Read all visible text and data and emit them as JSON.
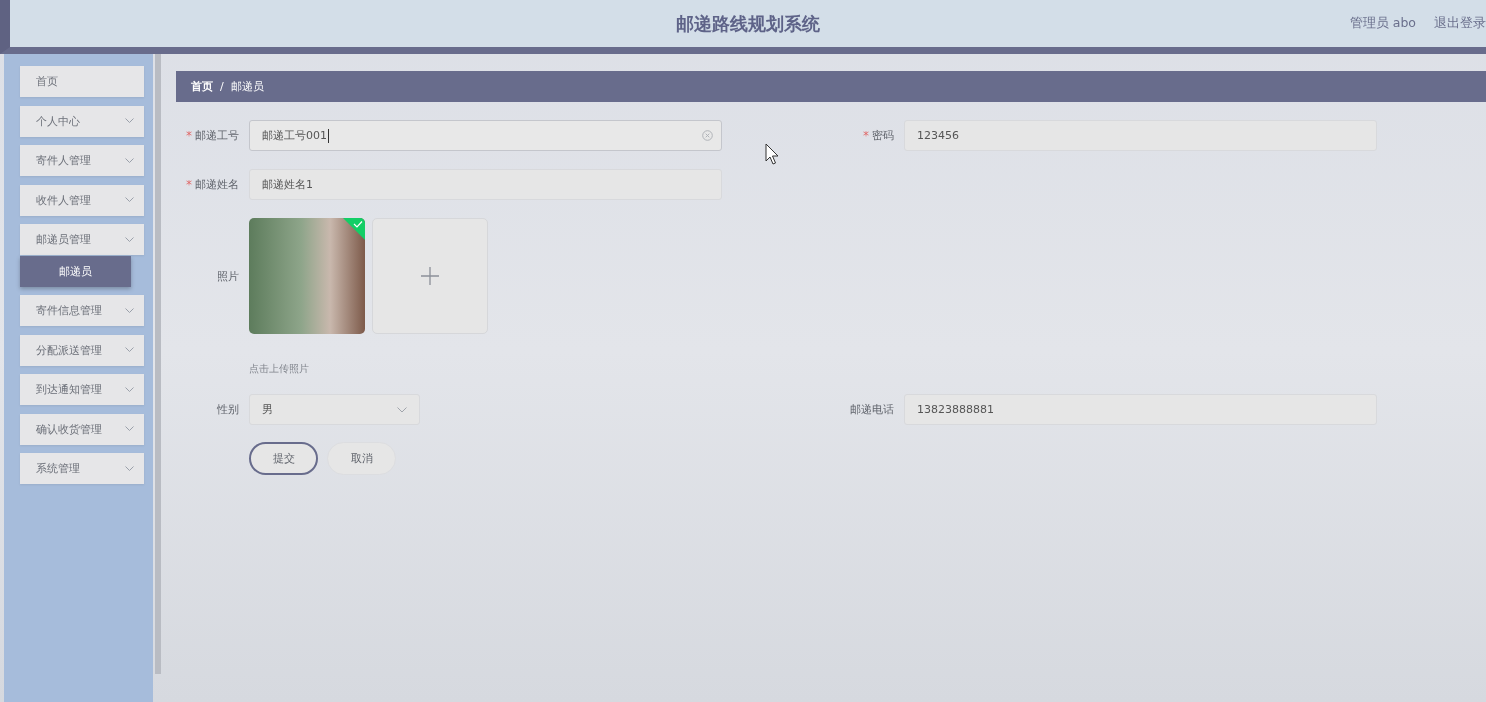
{
  "header": {
    "title": "邮递路线规划系统",
    "user": "管理员 abo",
    "logout": "退出登录"
  },
  "sidebar": {
    "items": [
      {
        "label": "首页",
        "kind": "link"
      },
      {
        "label": "个人中心",
        "kind": "submenu"
      },
      {
        "label": "寄件人管理",
        "kind": "submenu"
      },
      {
        "label": "收件人管理",
        "kind": "submenu"
      },
      {
        "label": "邮递员管理",
        "kind": "submenu",
        "children": [
          {
            "label": "邮递员",
            "selected": true
          }
        ]
      },
      {
        "label": "寄件信息管理",
        "kind": "submenu"
      },
      {
        "label": "分配派送管理",
        "kind": "submenu"
      },
      {
        "label": "到达通知管理",
        "kind": "submenu"
      },
      {
        "label": "确认收货管理",
        "kind": "submenu"
      },
      {
        "label": "系统管理",
        "kind": "submenu"
      }
    ]
  },
  "breadcrumb": {
    "separator": "/",
    "items": [
      "首页",
      "邮递员"
    ]
  },
  "form": {
    "rows": [
      [
        {
          "kind": "text",
          "label": "邮递工号",
          "required": true,
          "value": "邮递工号001",
          "focused": true
        },
        {
          "kind": "text",
          "label": "密码",
          "required": true,
          "value": "123456",
          "focused": false
        }
      ],
      [
        {
          "kind": "text",
          "label": "邮递姓名",
          "required": true,
          "value": "邮递姓名1",
          "focused": false
        }
      ],
      [
        {
          "kind": "upload",
          "label": "照片",
          "required": false,
          "uploaded": true,
          "hint": "点击上传照片"
        }
      ],
      [
        {
          "kind": "select",
          "label": "性别",
          "required": false,
          "value": "男"
        },
        {
          "kind": "text",
          "label": "邮递电话",
          "required": false,
          "value": "13823888881",
          "focused": false
        }
      ]
    ],
    "buttons": [
      {
        "label": "提交",
        "primary": true
      },
      {
        "label": "取消",
        "primary": false
      }
    ]
  }
}
